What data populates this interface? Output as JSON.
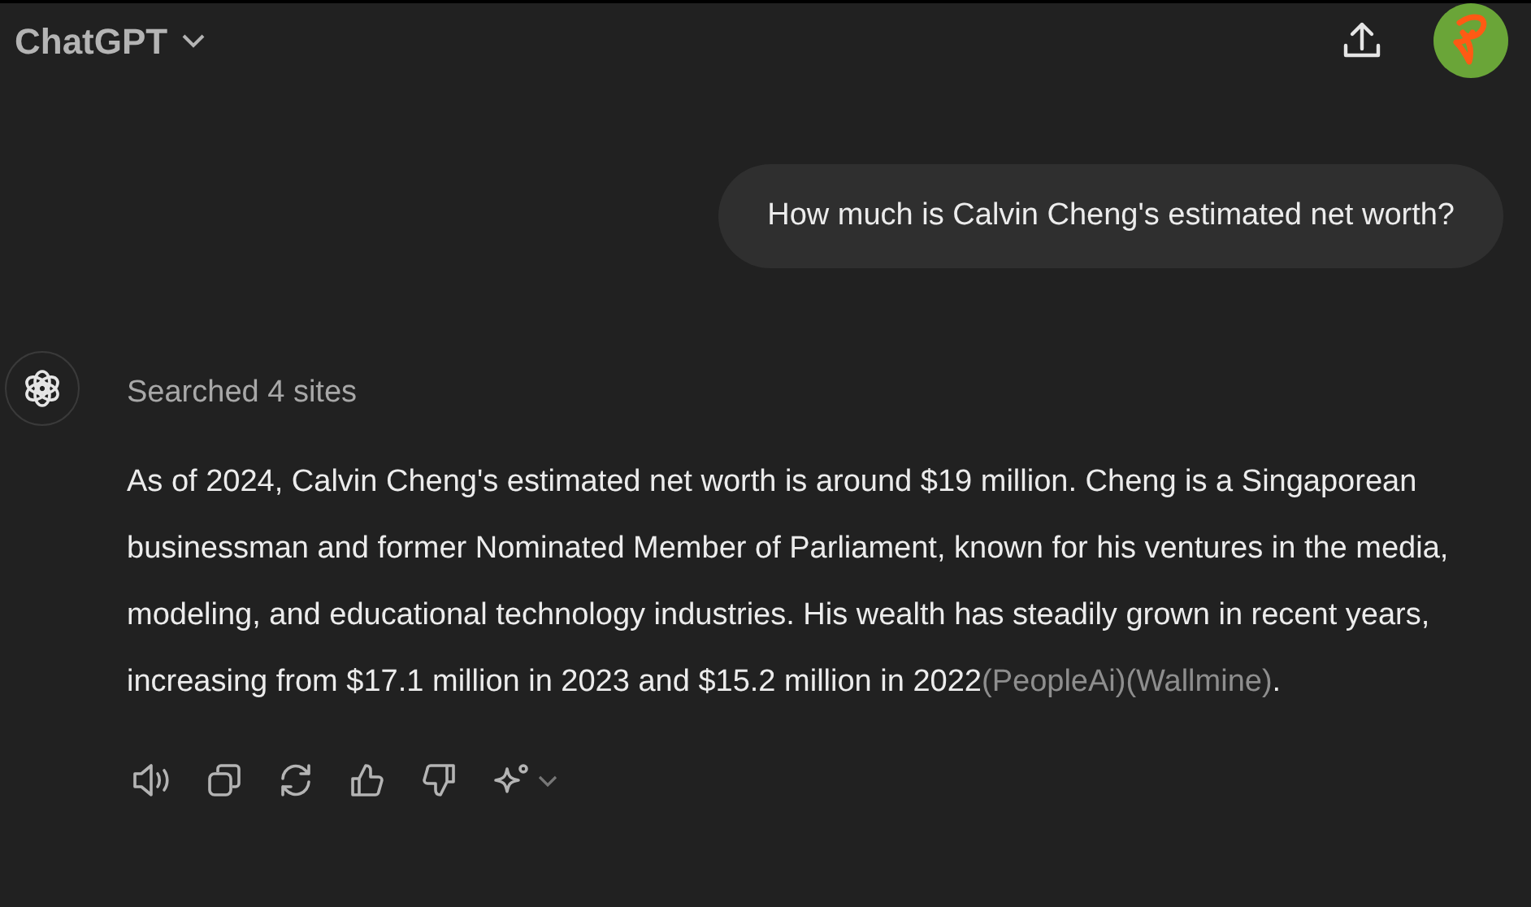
{
  "header": {
    "title": "ChatGPT"
  },
  "user_message": "How much is Calvin Cheng's estimated net worth?",
  "assistant": {
    "status": "Searched 4 sites",
    "body": "As of 2024, Calvin Cheng's estimated net worth is around $19 million. Cheng is a Singaporean businessman and former Nominated Member of Parliament, known for his ventures in the media, modeling, and educational technology industries. His wealth has steadily grown in recent years, increasing from $17.1 million in 2023 and $15.2 million in 2022",
    "citations": [
      "(PeopleAi)",
      "(Wallmine)"
    ],
    "ending": "."
  }
}
